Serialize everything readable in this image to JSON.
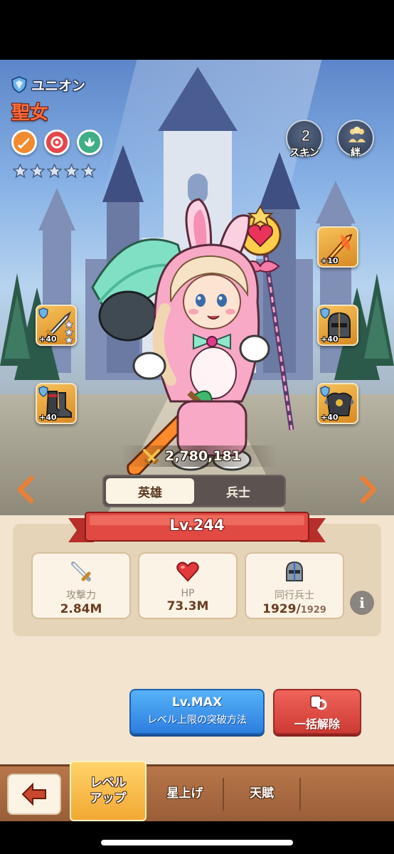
{
  "hero": {
    "faction": "ユニオン",
    "name": "聖女",
    "star_count": 5,
    "power": "2,780,181",
    "level": "Lv.244"
  },
  "top_buttons": {
    "skin": {
      "label": "スキン",
      "badge": "2"
    },
    "bond": {
      "label": "絆"
    }
  },
  "equipment": {
    "weapon": "+40",
    "helmet": "+40",
    "boots": "+40",
    "armor": "+40",
    "artifact": "+10"
  },
  "tabs": {
    "hero": "英雄",
    "soldier": "兵士"
  },
  "stats": {
    "attack": {
      "label": "攻撃力",
      "value": "2.84M"
    },
    "hp": {
      "label": "HP",
      "value": "73.3M"
    },
    "soldiers": {
      "label": "同行兵士",
      "value": "1929/",
      "max": "1929"
    }
  },
  "buttons": {
    "lvmax_title": "Lv.MAX",
    "lvmax_sub": "レベル上限の突破方法",
    "release": "一括解除"
  },
  "nav": {
    "levelup_line1": "レベル",
    "levelup_line2": "アップ",
    "starup": "星上げ",
    "talent": "天賦"
  },
  "colors": {
    "hero_name": "#ff6b3d",
    "panel_bg": "#f2e4cf",
    "banner_red": "#d9423c",
    "button_blue": "#2d7ee0",
    "button_red": "#cc3a33",
    "nav_active": "#f2a833"
  }
}
